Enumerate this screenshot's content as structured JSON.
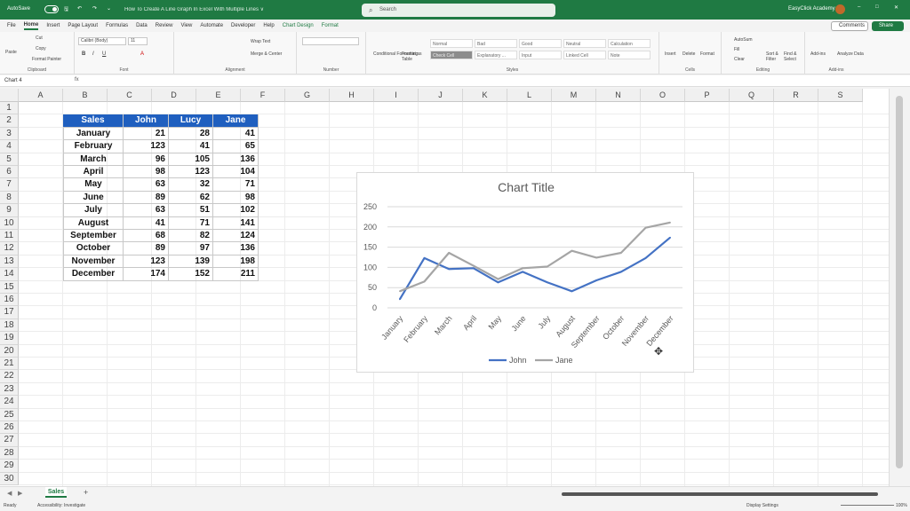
{
  "titlebar": {
    "autosave": "AutoSave",
    "toggle": "Off",
    "doc_title": "How To Create A Line Graph In Excel With Multiple Lines ∨",
    "search_placeholder": "Search",
    "user": "EasyClick Academy",
    "avatar": "EC",
    "min": "–",
    "max": "□",
    "close": "✕"
  },
  "menu": [
    "File",
    "Home",
    "Insert",
    "Page Layout",
    "Formulas",
    "Data",
    "Review",
    "View",
    "Automate",
    "Developer",
    "Help",
    "Chart Design",
    "Format"
  ],
  "buttons": {
    "comments": "Comments",
    "share": "Share"
  },
  "ribbon": {
    "clipboard": {
      "label": "Clipboard",
      "paste": "Paste",
      "cut": "Cut",
      "copy": "Copy",
      "format_painter": "Format Painter"
    },
    "font": {
      "label": "Font",
      "name": "Calibri (Body)",
      "size": "11"
    },
    "alignment": {
      "label": "Alignment",
      "wrap": "Wrap Text",
      "merge": "Merge & Center"
    },
    "number": {
      "label": "Number"
    },
    "styles": {
      "label": "Styles",
      "conditional": "Conditional Formatting",
      "format_table": "Format as Table",
      "cells": [
        "Normal",
        "Bad",
        "Good",
        "Neutral",
        "Calculation",
        "Check Cell",
        "Explanatory ...",
        "Input",
        "Linked Cell",
        "Note"
      ]
    },
    "cells": {
      "label": "Cells",
      "insert": "Insert",
      "delete": "Delete",
      "format": "Format"
    },
    "editing": {
      "label": "Editing",
      "autosum": "AutoSum",
      "fill": "Fill",
      "clear": "Clear",
      "sort": "Sort & Filter",
      "find": "Find & Select"
    },
    "addins": {
      "label": "Add-ins",
      "addins": "Add-ins",
      "analyze": "Analyze Data"
    }
  },
  "formula": {
    "namebox": "Chart 4",
    "fx": "fx"
  },
  "columns": [
    "A",
    "B",
    "C",
    "D",
    "E",
    "F",
    "G",
    "H",
    "I",
    "J",
    "K",
    "L",
    "M",
    "N",
    "O",
    "P",
    "Q",
    "R",
    "S"
  ],
  "rows": [
    "1",
    "2",
    "3",
    "4",
    "5",
    "6",
    "7",
    "8",
    "9",
    "10",
    "11",
    "12",
    "13",
    "14",
    "15",
    "16",
    "17",
    "18",
    "19",
    "20",
    "21",
    "22",
    "23",
    "24",
    "25",
    "26",
    "27",
    "28",
    "29",
    "30"
  ],
  "table": {
    "headers": [
      "Sales",
      "John",
      "Lucy",
      "Jane"
    ],
    "rows": [
      [
        "January",
        "21",
        "28",
        "41"
      ],
      [
        "February",
        "123",
        "41",
        "65"
      ],
      [
        "March",
        "96",
        "105",
        "136"
      ],
      [
        "April",
        "98",
        "123",
        "104"
      ],
      [
        "May",
        "63",
        "32",
        "71"
      ],
      [
        "June",
        "89",
        "62",
        "98"
      ],
      [
        "July",
        "63",
        "51",
        "102"
      ],
      [
        "August",
        "41",
        "71",
        "141"
      ],
      [
        "September",
        "68",
        "82",
        "124"
      ],
      [
        "October",
        "89",
        "97",
        "136"
      ],
      [
        "November",
        "123",
        "139",
        "198"
      ],
      [
        "December",
        "174",
        "152",
        "211"
      ]
    ]
  },
  "chart_data": {
    "type": "line",
    "title": "Chart Title",
    "categories": [
      "January",
      "February",
      "March",
      "April",
      "May",
      "June",
      "July",
      "August",
      "September",
      "October",
      "November",
      "December"
    ],
    "series": [
      {
        "name": "John",
        "color": "#4472c4",
        "values": [
          21,
          123,
          96,
          98,
          63,
          89,
          63,
          41,
          68,
          89,
          123,
          174
        ]
      },
      {
        "name": "Jane",
        "color": "#a5a5a5",
        "values": [
          41,
          65,
          136,
          104,
          71,
          98,
          102,
          141,
          124,
          136,
          198,
          211
        ]
      }
    ],
    "ylim": [
      0,
      250
    ],
    "yticks": [
      "0",
      "50",
      "100",
      "150",
      "200",
      "250"
    ],
    "grid": true,
    "legend": "bottom"
  },
  "sheet": {
    "tab": "Sales",
    "add": "+"
  },
  "status": {
    "ready": "Ready",
    "accessibility": "Accessibility: Investigate",
    "display": "Display Settings",
    "zoom": "100%"
  }
}
